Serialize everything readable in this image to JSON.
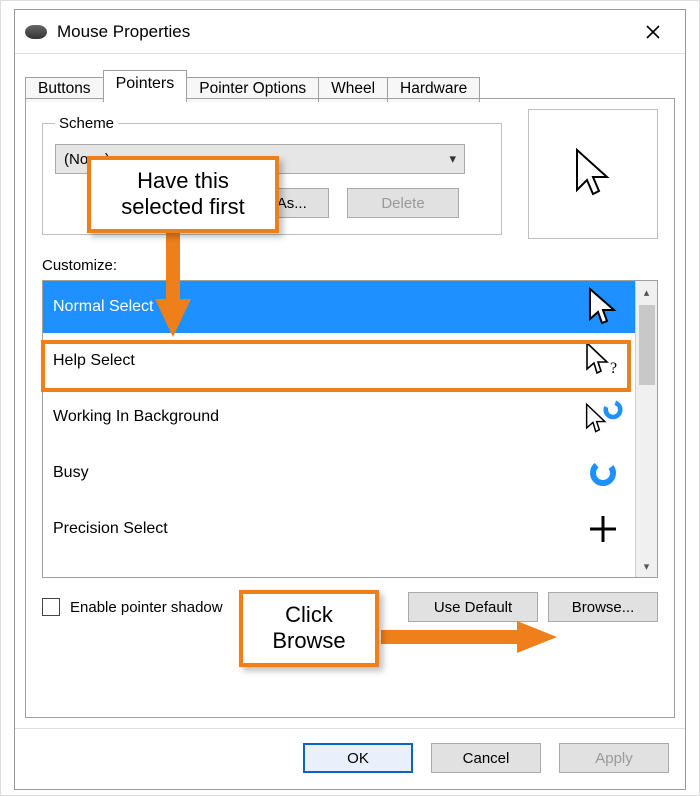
{
  "window": {
    "title": "Mouse Properties"
  },
  "tabs": [
    "Buttons",
    "Pointers",
    "Pointer Options",
    "Wheel",
    "Hardware"
  ],
  "active_tab_index": 1,
  "scheme": {
    "legend": "Scheme",
    "selected": "(None)",
    "save_label": "Save As...",
    "delete_label": "Delete"
  },
  "customize_label": "Customize:",
  "cursor_list": [
    {
      "name": "Normal Select",
      "icon": "arrow",
      "selected": true
    },
    {
      "name": "Help Select",
      "icon": "arrow-help",
      "selected": false
    },
    {
      "name": "Working In Background",
      "icon": "arrow-spin",
      "selected": false
    },
    {
      "name": "Busy",
      "icon": "spin",
      "selected": false
    },
    {
      "name": "Precision Select",
      "icon": "cross",
      "selected": false
    }
  ],
  "enable_shadow_label": "Enable pointer shadow",
  "use_default_label": "Use Default",
  "browse_label": "Browse...",
  "buttons": {
    "ok": "OK",
    "cancel": "Cancel",
    "apply": "Apply"
  },
  "annotations": {
    "first": "Have this\nselected first",
    "second": "Click\nBrowse"
  }
}
